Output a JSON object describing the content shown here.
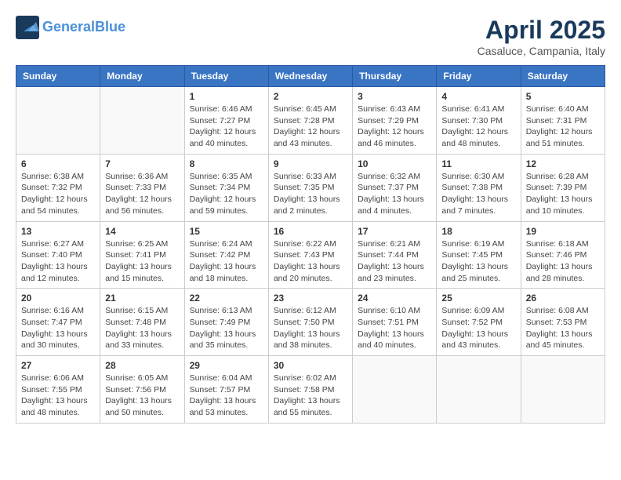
{
  "header": {
    "logo_line1": "General",
    "logo_line2": "Blue",
    "month_title": "April 2025",
    "subtitle": "Casaluce, Campania, Italy"
  },
  "weekdays": [
    "Sunday",
    "Monday",
    "Tuesday",
    "Wednesday",
    "Thursday",
    "Friday",
    "Saturday"
  ],
  "weeks": [
    [
      {
        "day": "",
        "sunrise": "",
        "sunset": "",
        "daylight": ""
      },
      {
        "day": "",
        "sunrise": "",
        "sunset": "",
        "daylight": ""
      },
      {
        "day": "1",
        "sunrise": "Sunrise: 6:46 AM",
        "sunset": "Sunset: 7:27 PM",
        "daylight": "Daylight: 12 hours and 40 minutes."
      },
      {
        "day": "2",
        "sunrise": "Sunrise: 6:45 AM",
        "sunset": "Sunset: 7:28 PM",
        "daylight": "Daylight: 12 hours and 43 minutes."
      },
      {
        "day": "3",
        "sunrise": "Sunrise: 6:43 AM",
        "sunset": "Sunset: 7:29 PM",
        "daylight": "Daylight: 12 hours and 46 minutes."
      },
      {
        "day": "4",
        "sunrise": "Sunrise: 6:41 AM",
        "sunset": "Sunset: 7:30 PM",
        "daylight": "Daylight: 12 hours and 48 minutes."
      },
      {
        "day": "5",
        "sunrise": "Sunrise: 6:40 AM",
        "sunset": "Sunset: 7:31 PM",
        "daylight": "Daylight: 12 hours and 51 minutes."
      }
    ],
    [
      {
        "day": "6",
        "sunrise": "Sunrise: 6:38 AM",
        "sunset": "Sunset: 7:32 PM",
        "daylight": "Daylight: 12 hours and 54 minutes."
      },
      {
        "day": "7",
        "sunrise": "Sunrise: 6:36 AM",
        "sunset": "Sunset: 7:33 PM",
        "daylight": "Daylight: 12 hours and 56 minutes."
      },
      {
        "day": "8",
        "sunrise": "Sunrise: 6:35 AM",
        "sunset": "Sunset: 7:34 PM",
        "daylight": "Daylight: 12 hours and 59 minutes."
      },
      {
        "day": "9",
        "sunrise": "Sunrise: 6:33 AM",
        "sunset": "Sunset: 7:35 PM",
        "daylight": "Daylight: 13 hours and 2 minutes."
      },
      {
        "day": "10",
        "sunrise": "Sunrise: 6:32 AM",
        "sunset": "Sunset: 7:37 PM",
        "daylight": "Daylight: 13 hours and 4 minutes."
      },
      {
        "day": "11",
        "sunrise": "Sunrise: 6:30 AM",
        "sunset": "Sunset: 7:38 PM",
        "daylight": "Daylight: 13 hours and 7 minutes."
      },
      {
        "day": "12",
        "sunrise": "Sunrise: 6:28 AM",
        "sunset": "Sunset: 7:39 PM",
        "daylight": "Daylight: 13 hours and 10 minutes."
      }
    ],
    [
      {
        "day": "13",
        "sunrise": "Sunrise: 6:27 AM",
        "sunset": "Sunset: 7:40 PM",
        "daylight": "Daylight: 13 hours and 12 minutes."
      },
      {
        "day": "14",
        "sunrise": "Sunrise: 6:25 AM",
        "sunset": "Sunset: 7:41 PM",
        "daylight": "Daylight: 13 hours and 15 minutes."
      },
      {
        "day": "15",
        "sunrise": "Sunrise: 6:24 AM",
        "sunset": "Sunset: 7:42 PM",
        "daylight": "Daylight: 13 hours and 18 minutes."
      },
      {
        "day": "16",
        "sunrise": "Sunrise: 6:22 AM",
        "sunset": "Sunset: 7:43 PM",
        "daylight": "Daylight: 13 hours and 20 minutes."
      },
      {
        "day": "17",
        "sunrise": "Sunrise: 6:21 AM",
        "sunset": "Sunset: 7:44 PM",
        "daylight": "Daylight: 13 hours and 23 minutes."
      },
      {
        "day": "18",
        "sunrise": "Sunrise: 6:19 AM",
        "sunset": "Sunset: 7:45 PM",
        "daylight": "Daylight: 13 hours and 25 minutes."
      },
      {
        "day": "19",
        "sunrise": "Sunrise: 6:18 AM",
        "sunset": "Sunset: 7:46 PM",
        "daylight": "Daylight: 13 hours and 28 minutes."
      }
    ],
    [
      {
        "day": "20",
        "sunrise": "Sunrise: 6:16 AM",
        "sunset": "Sunset: 7:47 PM",
        "daylight": "Daylight: 13 hours and 30 minutes."
      },
      {
        "day": "21",
        "sunrise": "Sunrise: 6:15 AM",
        "sunset": "Sunset: 7:48 PM",
        "daylight": "Daylight: 13 hours and 33 minutes."
      },
      {
        "day": "22",
        "sunrise": "Sunrise: 6:13 AM",
        "sunset": "Sunset: 7:49 PM",
        "daylight": "Daylight: 13 hours and 35 minutes."
      },
      {
        "day": "23",
        "sunrise": "Sunrise: 6:12 AM",
        "sunset": "Sunset: 7:50 PM",
        "daylight": "Daylight: 13 hours and 38 minutes."
      },
      {
        "day": "24",
        "sunrise": "Sunrise: 6:10 AM",
        "sunset": "Sunset: 7:51 PM",
        "daylight": "Daylight: 13 hours and 40 minutes."
      },
      {
        "day": "25",
        "sunrise": "Sunrise: 6:09 AM",
        "sunset": "Sunset: 7:52 PM",
        "daylight": "Daylight: 13 hours and 43 minutes."
      },
      {
        "day": "26",
        "sunrise": "Sunrise: 6:08 AM",
        "sunset": "Sunset: 7:53 PM",
        "daylight": "Daylight: 13 hours and 45 minutes."
      }
    ],
    [
      {
        "day": "27",
        "sunrise": "Sunrise: 6:06 AM",
        "sunset": "Sunset: 7:55 PM",
        "daylight": "Daylight: 13 hours and 48 minutes."
      },
      {
        "day": "28",
        "sunrise": "Sunrise: 6:05 AM",
        "sunset": "Sunset: 7:56 PM",
        "daylight": "Daylight: 13 hours and 50 minutes."
      },
      {
        "day": "29",
        "sunrise": "Sunrise: 6:04 AM",
        "sunset": "Sunset: 7:57 PM",
        "daylight": "Daylight: 13 hours and 53 minutes."
      },
      {
        "day": "30",
        "sunrise": "Sunrise: 6:02 AM",
        "sunset": "Sunset: 7:58 PM",
        "daylight": "Daylight: 13 hours and 55 minutes."
      },
      {
        "day": "",
        "sunrise": "",
        "sunset": "",
        "daylight": ""
      },
      {
        "day": "",
        "sunrise": "",
        "sunset": "",
        "daylight": ""
      },
      {
        "day": "",
        "sunrise": "",
        "sunset": "",
        "daylight": ""
      }
    ]
  ]
}
